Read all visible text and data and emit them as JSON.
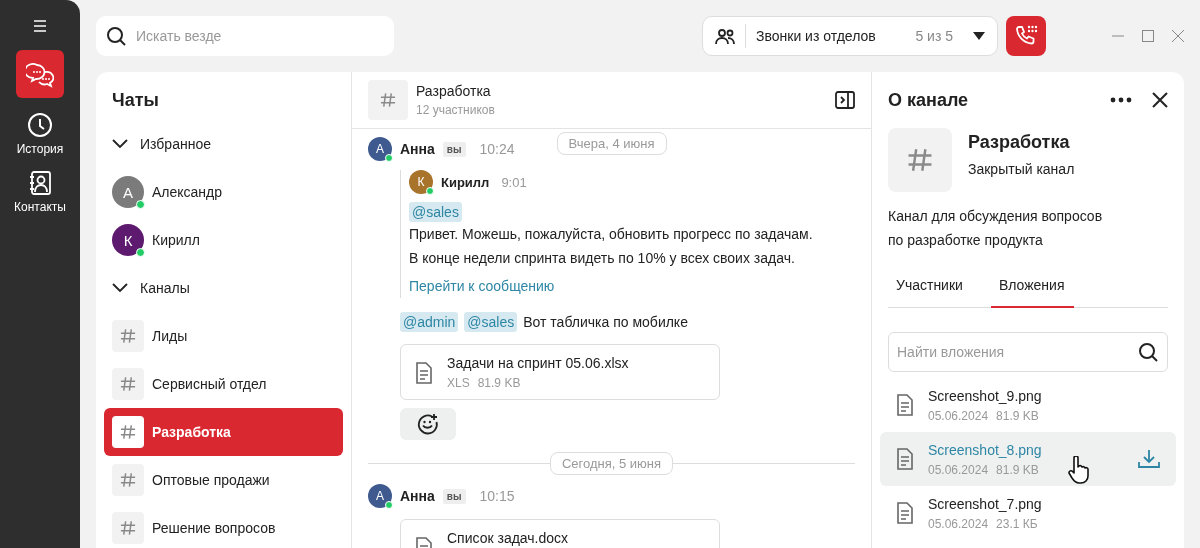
{
  "rail": {
    "items": [
      {
        "kind": "chats",
        "selected": true
      },
      {
        "kind": "history",
        "label": "История",
        "selected": false
      },
      {
        "kind": "contacts",
        "label": "Контакты",
        "selected": false
      }
    ]
  },
  "search": {
    "placeholder": "Искать везде"
  },
  "call_group": {
    "label": "Звонки из отделов",
    "count": "5 из 5"
  },
  "chat_list": {
    "title": "Чаты",
    "sections": [
      {
        "title": "Избранное",
        "expanded": true,
        "items": [
          {
            "kind": "person",
            "name": "Александр",
            "initial": "А",
            "color": "#7b7b7b",
            "online": true,
            "selected": false
          },
          {
            "kind": "person",
            "name": "Кирилл",
            "initial": "К",
            "color": "#5e1a6e",
            "online": true,
            "selected": false
          }
        ]
      },
      {
        "title": "Каналы",
        "expanded": true,
        "items": [
          {
            "kind": "channel",
            "name": "Лиды",
            "selected": false
          },
          {
            "kind": "channel",
            "name": "Сервисный отдел",
            "selected": false
          },
          {
            "kind": "channel",
            "name": "Разработка",
            "selected": true
          },
          {
            "kind": "channel",
            "name": "Оптовые продажи",
            "selected": false
          },
          {
            "kind": "channel",
            "name": "Решение вопросов",
            "selected": false
          }
        ]
      }
    ]
  },
  "chat": {
    "name": "Разработка",
    "members": "12 участников",
    "timeline": [
      {
        "kind": "date",
        "label": "Вчера, 4 июня",
        "sticky": true
      },
      {
        "kind": "message",
        "author": "Анна",
        "initial": "А",
        "color": "#3e5a8f",
        "online": true,
        "badge": "вы",
        "time": "10:24",
        "quote": {
          "author": "Кирилл",
          "initial": "К",
          "color": "#a8732a",
          "online": true,
          "time": "9:01",
          "mention": "@sales",
          "lines": [
            "Привет. Можешь, пожалуйста, обновить прогресс по задачам.",
            "В конце недели спринта видеть по 10% у всех своих задач."
          ],
          "link": "Перейти к сообщению"
        },
        "mentions": [
          "@admin",
          "@sales"
        ],
        "text": "Вот табличка по мобилке",
        "attachment": {
          "name": "Задачи на спринт 05.06.xlsx",
          "type": "XLS",
          "size": "81.9 KB"
        },
        "reaction_button": true
      },
      {
        "kind": "date",
        "label": "Сегодня, 5 июня",
        "sticky": false
      },
      {
        "kind": "message",
        "author": "Анна",
        "initial": "А",
        "color": "#3e5a8f",
        "online": true,
        "badge": "вы",
        "time": "10:15",
        "attachment": {
          "name": "Список задач.docx"
        }
      }
    ]
  },
  "info": {
    "title": "О канале",
    "name": "Разработка",
    "type": "Закрытый канал",
    "description": "Канал для обсуждения вопросов по разработке продукта",
    "tabs": [
      {
        "label": "Участники",
        "selected": false
      },
      {
        "label": "Вложения",
        "selected": true
      }
    ],
    "search": {
      "placeholder": "Найти вложения"
    },
    "files": [
      {
        "name": "Screenshot_9.png",
        "date": "05.06.2024",
        "size": "81.9 KB",
        "selected": false
      },
      {
        "name": "Screenshot_8.png",
        "date": "05.06.2024",
        "size": "81.9 KB",
        "selected": true
      },
      {
        "name": "Screenshot_7.png",
        "date": "05.06.2024",
        "size": "23.1 КБ",
        "selected": false
      }
    ]
  }
}
